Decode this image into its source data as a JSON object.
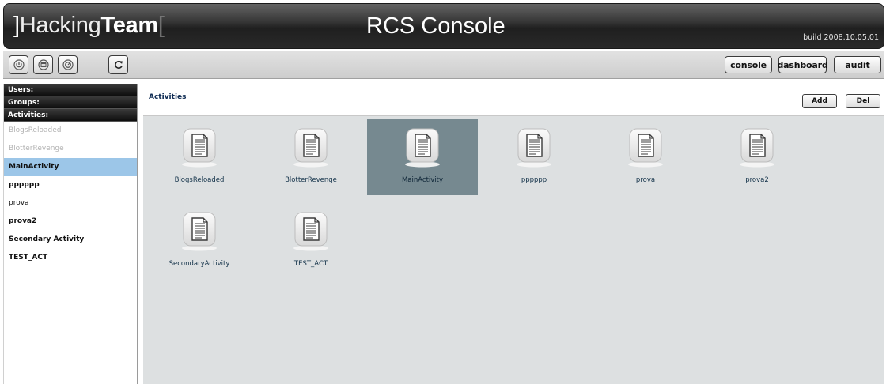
{
  "header": {
    "logo_open": "]",
    "logo_hacking": "Hacking",
    "logo_team": "Team",
    "logo_close": "[",
    "title": "RCS Console",
    "build": "build 2008.10.05.01"
  },
  "toolbar": {
    "icons": [
      "power-icon",
      "window-icon",
      "clock-icon",
      "refresh-icon"
    ],
    "nav": {
      "console": "console",
      "dashboard": "dashboard",
      "audit": "audit"
    }
  },
  "sidebar": {
    "sections": {
      "users": "Users:",
      "groups": "Groups:",
      "activities": "Activities:"
    },
    "items": [
      {
        "label": "BlogsReloaded",
        "state": "dim"
      },
      {
        "label": "BlotterRevenge",
        "state": "dim"
      },
      {
        "label": "MainActivity",
        "state": "selected"
      },
      {
        "label": "pppppp",
        "state": "bold"
      },
      {
        "label": "prova",
        "state": "normal"
      },
      {
        "label": "prova2",
        "state": "bold"
      },
      {
        "label": "Secondary Activity",
        "state": "bold"
      },
      {
        "label": "TEST_ACT",
        "state": "bold"
      }
    ]
  },
  "main": {
    "title": "Activities",
    "add_label": "Add",
    "del_label": "Del",
    "selected_color": "#768990",
    "grid": [
      {
        "label": "BlogsReloaded"
      },
      {
        "label": "BlotterRevenge"
      },
      {
        "label": "MainActivity",
        "selected": true
      },
      {
        "label": "pppppp"
      },
      {
        "label": "prova"
      },
      {
        "label": "prova2"
      },
      {
        "label": "SecondaryActivity"
      },
      {
        "label": "TEST_ACT"
      }
    ]
  }
}
